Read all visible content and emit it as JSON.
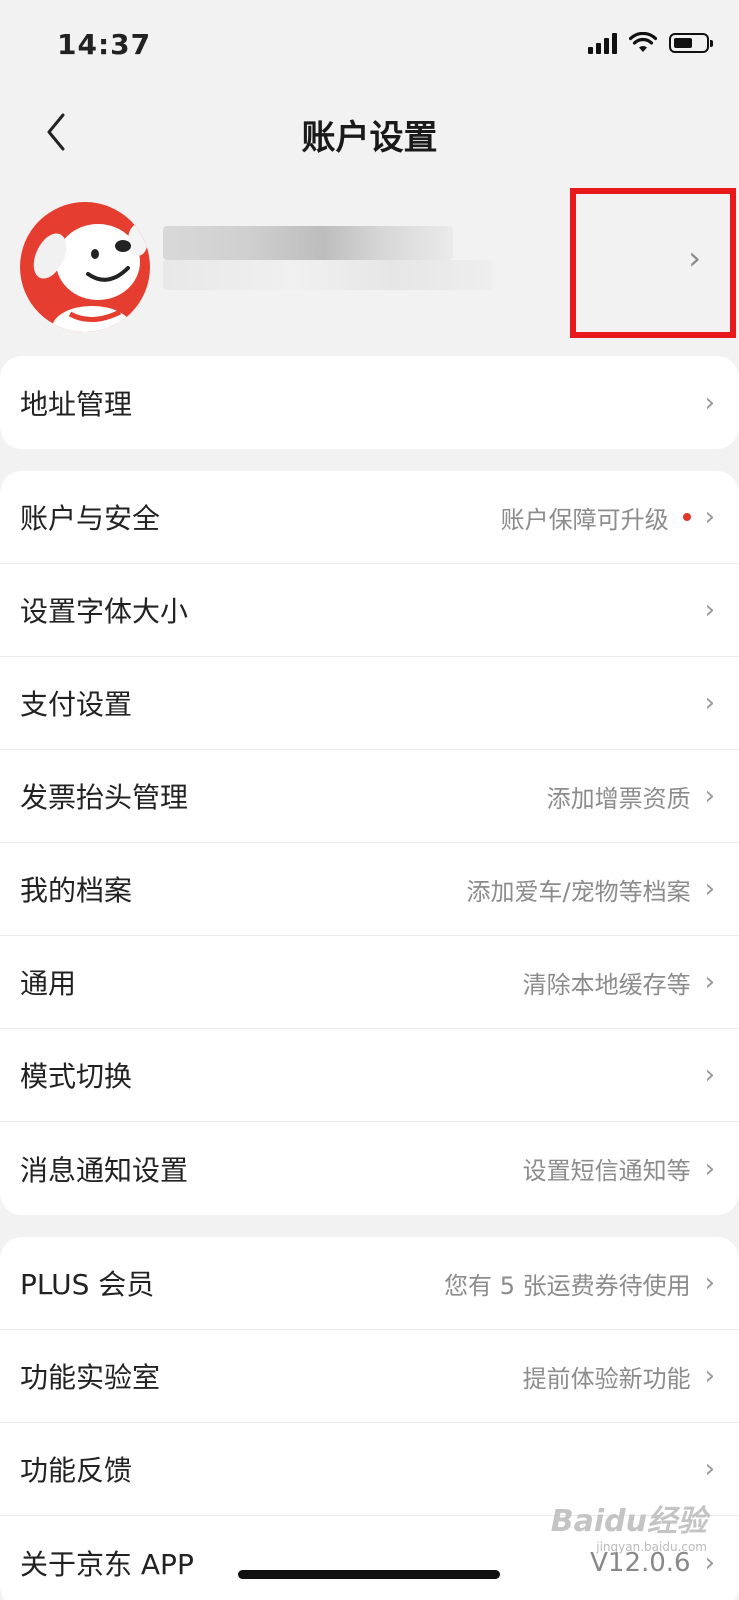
{
  "status_bar": {
    "time": "14:37"
  },
  "nav": {
    "title": "账户设置"
  },
  "profile": {
    "chevron": "›"
  },
  "groups": [
    {
      "rows": [
        {
          "label": "地址管理",
          "hint": ""
        }
      ]
    },
    {
      "rows": [
        {
          "label": "账户与安全",
          "hint": "账户保障可升级",
          "badge_dot": true
        },
        {
          "label": "设置字体大小",
          "hint": ""
        },
        {
          "label": "支付设置",
          "hint": ""
        },
        {
          "label": "发票抬头管理",
          "hint": "添加增票资质"
        },
        {
          "label": "我的档案",
          "hint": "添加爱车/宠物等档案"
        },
        {
          "label": "通用",
          "hint": "清除本地缓存等"
        },
        {
          "label": "模式切换",
          "hint": ""
        },
        {
          "label": "消息通知设置",
          "hint": "设置短信通知等"
        }
      ]
    },
    {
      "rows": [
        {
          "label": "PLUS 会员",
          "hint": "您有 5 张运费券待使用"
        },
        {
          "label": "功能实验室",
          "hint": "提前体验新功能"
        },
        {
          "label": "功能反馈",
          "hint": ""
        },
        {
          "label": "关于京东 APP",
          "hint": "V12.0.6"
        }
      ]
    }
  ],
  "watermark": {
    "brand": "Baidu经验",
    "url": "jingyan.baidu.com"
  },
  "colors": {
    "accent_red": "#e8191a",
    "avatar_bg": "#e53d2f",
    "dot_red": "#e5352b"
  }
}
